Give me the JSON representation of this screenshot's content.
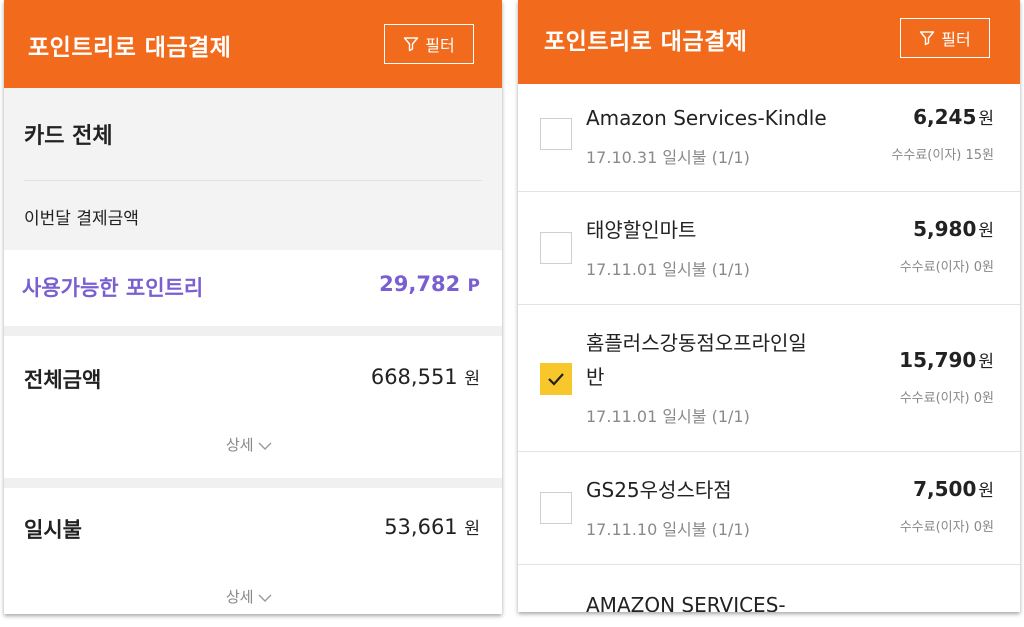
{
  "left": {
    "header": {
      "title": "포인트리로 대금결제",
      "filter_label": "필터"
    },
    "card_label": "카드 전체",
    "this_month_label": "이번달 결제금액",
    "points": {
      "label": "사용가능한 포인트리",
      "value": "29,782",
      "unit": "P"
    },
    "total": {
      "label": "전체금액",
      "value": "668,551",
      "unit": "원",
      "more": "상세"
    },
    "lump": {
      "label": "일시불",
      "value": "53,661",
      "unit": "원",
      "more": "상세"
    }
  },
  "right": {
    "header": {
      "title": "포인트리로 대금결제",
      "filter_label": "필터"
    },
    "transactions": [
      {
        "merchant": "Amazon Services-Kindle",
        "date": "17.10.31  일시불 (1/1)",
        "amount": "6,245",
        "unit": "원",
        "fee": "수수료(이자) 15원",
        "checked": false
      },
      {
        "merchant": "태양할인마트",
        "date": "17.11.01  일시불 (1/1)",
        "amount": "5,980",
        "unit": "원",
        "fee": "수수료(이자) 0원",
        "checked": false
      },
      {
        "merchant_line1": "홈플러스강동점오프라인일",
        "merchant_line2": "반",
        "date": "17.11.01  일시불 (1/1)",
        "amount": "15,790",
        "unit": "원",
        "fee": "수수료(이자) 0원",
        "checked": true
      },
      {
        "merchant": "GS25우성스타점",
        "date": "17.11.10  일시불 (1/1)",
        "amount": "7,500",
        "unit": "원",
        "fee": "수수료(이자) 0원",
        "checked": false
      },
      {
        "merchant": "AMAZON SERVICES-"
      }
    ]
  },
  "colors": {
    "header": "#f26b1d",
    "accent_purple": "#7a5fd1",
    "check_yellow": "#f8c72c"
  },
  "icons": [
    "filter-icon",
    "chevron-down-icon",
    "check-icon"
  ]
}
